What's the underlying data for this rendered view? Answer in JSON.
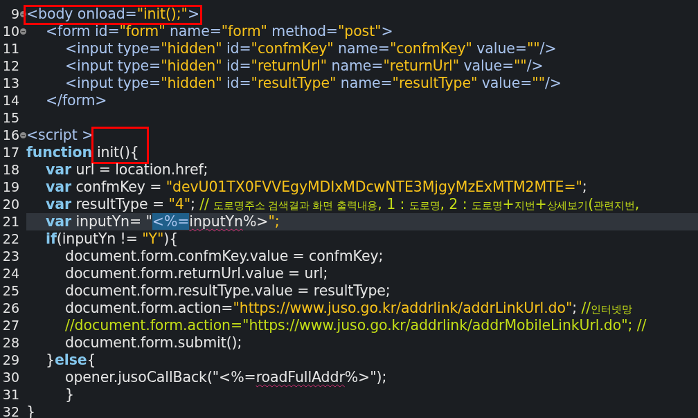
{
  "editor": {
    "lines": [
      {
        "number": "9",
        "fold": true,
        "current": false,
        "boxed": true,
        "tokens": [
          {
            "kind": "tag",
            "text": "<body onload="
          },
          {
            "kind": "string",
            "text": "\"init();\""
          },
          {
            "kind": "tag",
            "text": ">"
          }
        ],
        "children": [
          {
            "number": "10",
            "fold": true,
            "current": false,
            "boxed": false,
            "tokens": [
              {
                "kind": "tag",
                "text": "<form id="
              },
              {
                "kind": "string",
                "text": "\"form\""
              },
              {
                "kind": "tag",
                "text": " name="
              },
              {
                "kind": "string",
                "text": "\"form\""
              },
              {
                "kind": "tag",
                "text": " method="
              },
              {
                "kind": "string",
                "text": "\"post\""
              },
              {
                "kind": "tag",
                "text": ">"
              }
            ],
            "children": [
              {
                "number": "11",
                "fold": false,
                "current": false,
                "boxed": false,
                "tokens": [
                  {
                    "kind": "tag",
                    "text": "<input type="
                  },
                  {
                    "kind": "string",
                    "text": "\"hidden\""
                  },
                  {
                    "kind": "tag",
                    "text": " id="
                  },
                  {
                    "kind": "string",
                    "text": "\"confmKey\""
                  },
                  {
                    "kind": "tag",
                    "text": " name="
                  },
                  {
                    "kind": "string",
                    "text": "\"confmKey\""
                  },
                  {
                    "kind": "tag",
                    "text": " value="
                  },
                  {
                    "kind": "string",
                    "text": "\"\""
                  },
                  {
                    "kind": "tag",
                    "text": "/>"
                  }
                ]
              },
              {
                "number": "12",
                "fold": false,
                "current": false,
                "boxed": false,
                "tokens": [
                  {
                    "kind": "tag",
                    "text": "<input type="
                  },
                  {
                    "kind": "string",
                    "text": "\"hidden\""
                  },
                  {
                    "kind": "tag",
                    "text": " id="
                  },
                  {
                    "kind": "string",
                    "text": "\"returnUrl\""
                  },
                  {
                    "kind": "tag",
                    "text": " name="
                  },
                  {
                    "kind": "string",
                    "text": "\"returnUrl\""
                  },
                  {
                    "kind": "tag",
                    "text": " value="
                  },
                  {
                    "kind": "string",
                    "text": "\"\""
                  },
                  {
                    "kind": "tag",
                    "text": "/>"
                  }
                ]
              },
              {
                "number": "13",
                "fold": false,
                "current": false,
                "boxed": false,
                "tokens": [
                  {
                    "kind": "tag",
                    "text": "<input type="
                  },
                  {
                    "kind": "string",
                    "text": "\"hidden\""
                  },
                  {
                    "kind": "tag",
                    "text": " id="
                  },
                  {
                    "kind": "string",
                    "text": "\"resultType\""
                  },
                  {
                    "kind": "tag",
                    "text": " name="
                  },
                  {
                    "kind": "string",
                    "text": "\"resultType\""
                  },
                  {
                    "kind": "tag",
                    "text": " value="
                  },
                  {
                    "kind": "string",
                    "text": "\"\""
                  },
                  {
                    "kind": "tag",
                    "text": "/>"
                  }
                ]
              }
            ]
          },
          {
            "number": "14",
            "fold": false,
            "current": false,
            "boxed": false,
            "tokens": [
              {
                "kind": "tag",
                "text": "</form>"
              }
            ]
          }
        ]
      },
      {
        "number": "15",
        "fold": false,
        "current": false,
        "boxed": false
      },
      {
        "number": "16",
        "fold": true,
        "current": false,
        "boxed": false,
        "tokens": [
          {
            "kind": "tag",
            "text": "<script >"
          }
        ]
      },
      {
        "number": "17",
        "fold": false,
        "current": false,
        "boxed": false,
        "tokens": [
          {
            "kind": "keyword",
            "text": "function "
          },
          {
            "kind": "boxed",
            "text": "init(){"
          }
        ],
        "children": [
          {
            "number": "18",
            "fold": false,
            "current": false,
            "boxed": false,
            "tokens": [
              {
                "kind": "keyword",
                "text": "var"
              },
              {
                "kind": "plain",
                "text": " url = location.href;"
              }
            ]
          },
          {
            "number": "19",
            "fold": false,
            "current": false,
            "boxed": false,
            "tokens": [
              {
                "kind": "keyword",
                "text": "var"
              },
              {
                "kind": "plain",
                "text": " confmKey = "
              },
              {
                "kind": "string",
                "text": "\"devU01TX0FVVEgyMDIxMDcwNTE3MjgyMzExMTM2MTE=\""
              },
              {
                "kind": "plain",
                "text": ";"
              }
            ]
          },
          {
            "number": "20",
            "fold": false,
            "current": false,
            "boxed": false,
            "tokens": [
              {
                "kind": "keyword",
                "text": "var"
              },
              {
                "kind": "plain",
                "text": " resultType = "
              },
              {
                "kind": "string",
                "text": "\"4\""
              },
              {
                "kind": "plain",
                "text": "; "
              },
              {
                "kind": "comment",
                "text": "// 도로명주소 검색결과 화면 출력내용, 1 : 도로명, 2 : 도로명+지번+상세보기(관련지번,"
              }
            ]
          },
          {
            "number": "21",
            "fold": false,
            "current": true,
            "boxed": false,
            "tokens": [
              {
                "kind": "keyword",
                "text": "var"
              },
              {
                "kind": "plain",
                "text": " inputYn= \""
              },
              {
                "kind": "selection",
                "text": "<%="
              },
              {
                "kind": "misspelled",
                "text": "inputYn"
              },
              {
                "kind": "plain",
                "text": "%>"
              },
              {
                "kind": "string",
                "text": "\";"
              }
            ]
          },
          {
            "number": "22",
            "fold": false,
            "current": false,
            "boxed": false,
            "tokens": [
              {
                "kind": "keyword",
                "text": "if"
              },
              {
                "kind": "plain",
                "text": "(inputYn != "
              },
              {
                "kind": "string",
                "text": "\"Y\""
              },
              {
                "kind": "plain",
                "text": "){"
              }
            ],
            "children": [
              {
                "number": "23",
                "fold": false,
                "current": false,
                "boxed": false,
                "tokens": [
                  {
                    "kind": "plain",
                    "text": "document.form.confmKey.value = confmKey;"
                  }
                ]
              },
              {
                "number": "24",
                "fold": false,
                "current": false,
                "boxed": false,
                "tokens": [
                  {
                    "kind": "plain",
                    "text": "document.form.returnUrl.value = url;"
                  }
                ]
              },
              {
                "number": "25",
                "fold": false,
                "current": false,
                "boxed": false,
                "tokens": [
                  {
                    "kind": "plain",
                    "text": "document.form.resultType.value = resultType;"
                  }
                ]
              },
              {
                "number": "26",
                "fold": false,
                "current": false,
                "boxed": false,
                "tokens": [
                  {
                    "kind": "plain",
                    "text": "document.form.action="
                  },
                  {
                    "kind": "string",
                    "text": "\"https://www.juso.go.kr/addrlink/addrLinkUrl.do\""
                  },
                  {
                    "kind": "plain",
                    "text": "; "
                  },
                  {
                    "kind": "comment",
                    "text": "//인터넷망"
                  }
                ]
              },
              {
                "number": "27",
                "fold": false,
                "current": false,
                "boxed": false,
                "tokens": [
                  {
                    "kind": "comment",
                    "text": "//document.form.action=\"https://www.juso.go.kr/addrlink/addrMobileLinkUrl.do\"; //"
                  }
                ]
              },
              {
                "number": "28",
                "fold": false,
                "current": false,
                "boxed": false,
                "tokens": [
                  {
                    "kind": "plain",
                    "text": "document.form.submit();"
                  }
                ]
              }
            ]
          },
          {
            "number": "29",
            "fold": false,
            "current": false,
            "boxed": false,
            "tokens": [
              {
                "kind": "plain",
                "text": "}"
              },
              {
                "kind": "keyword",
                "text": "else"
              },
              {
                "kind": "plain",
                "text": "{"
              }
            ],
            "children": [
              {
                "number": "30",
                "fold": false,
                "current": false,
                "boxed": false,
                "tokens": [
                  {
                    "kind": "plain",
                    "text": "opener.jusoCallBack(\"<%="
                  },
                  {
                    "kind": "misspelled",
                    "text": "roadFullAddr"
                  },
                  {
                    "kind": "plain",
                    "text": "%>\");"
                  }
                ]
              },
              {
                "number": "31",
                "fold": false,
                "current": false,
                "boxed": false,
                "tokens": [
                  {
                    "kind": "plain",
                    "text": "}"
                  }
                ]
              }
            ]
          }
        ]
      },
      {
        "number": "32",
        "fold": false,
        "current": false,
        "boxed": false,
        "tokens": [
          {
            "kind": "plain",
            "text": "}"
          }
        ]
      }
    ]
  }
}
